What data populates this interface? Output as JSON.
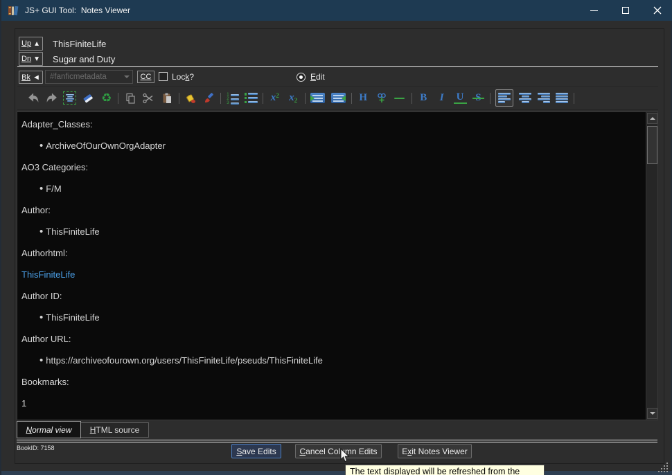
{
  "window": {
    "title": "JS+ GUI Tool:  Notes Viewer"
  },
  "nav": {
    "up_button": {
      "text": "Up",
      "u_start": 0,
      "u_len": 2
    },
    "down_button": {
      "text": "Dn",
      "u_start": 0,
      "u_len": 2
    },
    "up_arrow": "▲",
    "down_arrow": "▼",
    "current_title": "ThisFiniteLife",
    "current_subtitle": "Sugar and Duty"
  },
  "toolbar": {
    "back_button": {
      "text": "Bk",
      "u_start": 0,
      "u_len": 2
    },
    "back_arrow": "◄",
    "combo_value": "#fanficmetadata",
    "cc_button": {
      "text": "CC",
      "u_start": 0,
      "u_len": 2
    },
    "lock_label": {
      "text": "Lock?",
      "u_start": 3,
      "u_len": 1
    },
    "edit_label": {
      "text": "Edit",
      "u_start": 0,
      "u_len": 1
    }
  },
  "format_toolbar": {
    "icons": [
      "undo",
      "redo",
      "format-block",
      "eraser",
      "recycle",
      "copy",
      "cut",
      "paste",
      "fill-color",
      "brush",
      "ordered-list",
      "unordered-list",
      "superscript",
      "subscript",
      "indent",
      "outdent",
      "heading",
      "anchor",
      "horizontal-rule",
      "bold",
      "italic",
      "underline",
      "strikethrough",
      "align-left",
      "align-center",
      "align-right",
      "justify"
    ],
    "active": "align-left",
    "glyphs": {
      "heading": "H",
      "bold": "B",
      "italic": "I",
      "underline": "U",
      "strikethrough": "S",
      "sup_base": "x",
      "sup_n": "2",
      "sub_base": "x",
      "sub_n": "2",
      "recycle": "♻"
    }
  },
  "note": {
    "bullet_char": "•",
    "lines": [
      {
        "style": "label",
        "text": "Adapter_Classes:"
      },
      {
        "style": "bullet",
        "text": "ArchiveOfOurOwnOrgAdapter"
      },
      {
        "style": "label",
        "text": "AO3 Categories:"
      },
      {
        "style": "bullet",
        "text": "F/M"
      },
      {
        "style": "label",
        "text": "Author:"
      },
      {
        "style": "bullet",
        "text": "ThisFiniteLife"
      },
      {
        "style": "label",
        "text": "Authorhtml:"
      },
      {
        "style": "link",
        "text": "ThisFiniteLife"
      },
      {
        "style": "label",
        "text": "Author ID:"
      },
      {
        "style": "bullet",
        "text": "ThisFiniteLife"
      },
      {
        "style": "label",
        "text": "Author URL:"
      },
      {
        "style": "bullet",
        "text": "https://archiveofourown.org/users/ThisFiniteLife/pseuds/ThisFiniteLife"
      },
      {
        "style": "label",
        "text": "Bookmarks:"
      },
      {
        "style": "plain",
        "text": "1"
      }
    ]
  },
  "tabs": {
    "normal": {
      "text": "Normal view",
      "u_start": 0,
      "u_len": 1
    },
    "html": {
      "text": "HTML source",
      "u_start": 0,
      "u_len": 1
    }
  },
  "status": {
    "book_id": "BookID: 7158"
  },
  "buttons": {
    "save": {
      "text": "Save Edits",
      "u_start": 0,
      "u_len": 1
    },
    "cancel": {
      "text": "Cancel Column Edits",
      "u_start": 0,
      "u_len": 1
    },
    "exit": {
      "text": "Exit Notes Viewer",
      "u_start": 1,
      "u_len": 1
    }
  },
  "tooltip": {
    "text": "The text displayed will be refreshed from the"
  }
}
